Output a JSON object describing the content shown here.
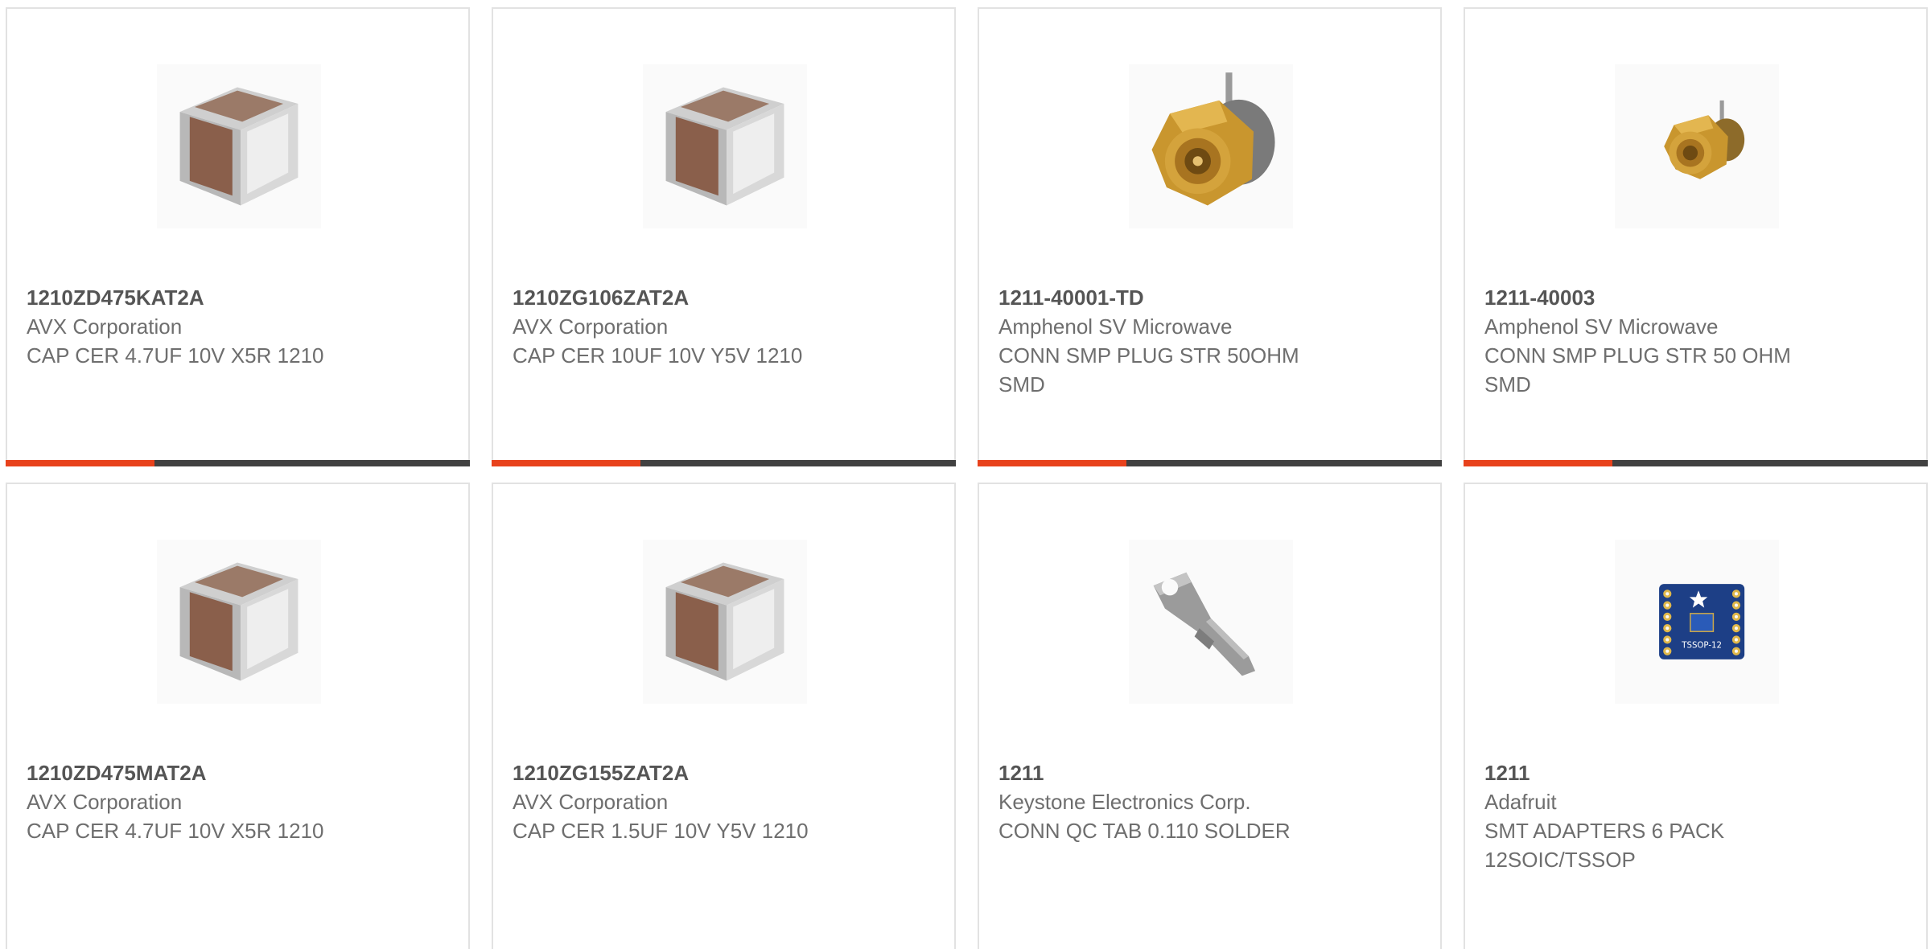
{
  "products": [
    {
      "part_number": "1210ZD475KAT2A",
      "manufacturer": "AVX Corporation",
      "description": "CAP CER 4.7UF 10V X5R 1210",
      "image": "capacitor-chip-icon",
      "progress": 0.32
    },
    {
      "part_number": "1210ZG106ZAT2A",
      "manufacturer": "AVX Corporation",
      "description": "CAP CER 10UF 10V Y5V 1210",
      "image": "capacitor-chip-icon",
      "progress": 0.32
    },
    {
      "part_number": "1211-40001-TD",
      "manufacturer": "Amphenol SV Microwave",
      "description": "CONN SMP PLUG STR 50OHM SMD",
      "image": "smp-connector-icon",
      "progress": 0.32
    },
    {
      "part_number": "1211-40003",
      "manufacturer": "Amphenol SV Microwave",
      "description": "CONN SMP PLUG STR 50 OHM SMD",
      "image": "smp-connector-small-icon",
      "progress": 0.32
    },
    {
      "part_number": "1210ZD475MAT2A",
      "manufacturer": "AVX Corporation",
      "description": "CAP CER 4.7UF 10V X5R 1210",
      "image": "capacitor-chip-icon"
    },
    {
      "part_number": "1210ZG155ZAT2A",
      "manufacturer": "AVX Corporation",
      "description": "CAP CER 1.5UF 10V Y5V 1210",
      "image": "capacitor-chip-icon"
    },
    {
      "part_number": "1211",
      "manufacturer": "Keystone Electronics Corp.",
      "description": "CONN QC TAB 0.110 SOLDER",
      "image": "qc-tab-terminal-icon"
    },
    {
      "part_number": "1211",
      "manufacturer": "Adafruit",
      "description": "SMT ADAPTERS 6 PACK 12SOIC/TSSOP",
      "image": "tssop-adapter-board-icon"
    }
  ],
  "colors": {
    "accent": "#e8421c",
    "bar_track": "#414141",
    "card_border": "#e2e2e2",
    "part_number_text": "#555555",
    "body_text": "#6e6e6e"
  },
  "image_labels": {
    "tssop_board": "TSSOP-12"
  }
}
